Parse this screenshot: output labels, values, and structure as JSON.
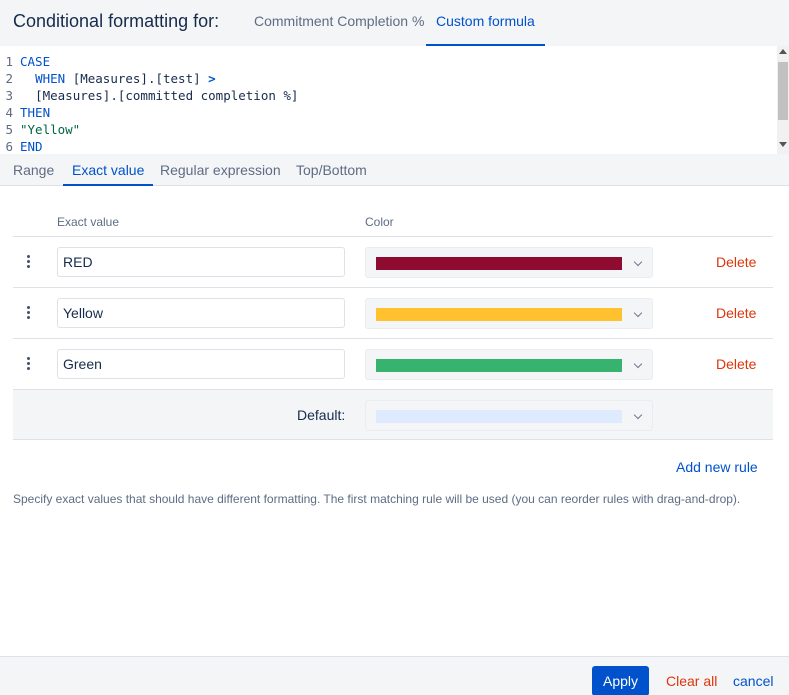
{
  "header": {
    "title": "Conditional formatting for:",
    "tabs": [
      {
        "label": "Commitment Completion %"
      },
      {
        "label": "Custom formula"
      }
    ]
  },
  "editor": {
    "line_numbers": [
      "1",
      "2",
      "3",
      "4",
      "5",
      "6"
    ],
    "lines": [
      {
        "kw": "CASE",
        "rest": ""
      },
      {
        "indent": "  ",
        "kw": "WHEN",
        "rest": " [Measures].[test] ",
        "op": ">"
      },
      {
        "indent": "  ",
        "kw": "",
        "rest": "[Measures].[committed completion %]"
      },
      {
        "kw": "THEN",
        "rest": ""
      },
      {
        "str": "\"Yellow\""
      },
      {
        "kw": "END",
        "rest": ""
      }
    ]
  },
  "subtabs": [
    "Range",
    "Exact value",
    "Regular expression",
    "Top/Bottom"
  ],
  "table": {
    "col_value": "Exact value",
    "col_color": "Color",
    "rows": [
      {
        "value": "RED",
        "color": "#8f0c30",
        "delete": "Delete"
      },
      {
        "value": "Yellow",
        "color": "#ffc12e",
        "delete": "Delete"
      },
      {
        "value": "Green",
        "color": "#36b36f",
        "delete": "Delete"
      }
    ],
    "default_label": "Default:",
    "default_color": "#deebff"
  },
  "add_rule": "Add new rule",
  "helper_text": "Specify exact values that should have different formatting. The first matching rule will be used (you can reorder rules with drag-and-drop).",
  "footer": {
    "apply": "Apply",
    "clear": "Clear all",
    "cancel": "cancel"
  }
}
